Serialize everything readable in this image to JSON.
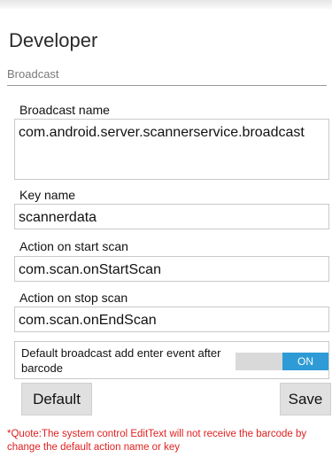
{
  "page": {
    "title": "Developer",
    "section": "Broadcast"
  },
  "broadcast_name": {
    "label": "Broadcast name",
    "value": "com.android.server.scannerservice.broadcast"
  },
  "key_name": {
    "label": "Key name",
    "value": "scannerdata"
  },
  "action_start": {
    "label": "Action on start scan",
    "value": "com.scan.onStartScan"
  },
  "action_stop": {
    "label": "Action on stop scan",
    "value": "com.scan.onEndScan"
  },
  "enter_toggle": {
    "label": "Default broadcast add enter event after barcode",
    "state": "ON"
  },
  "buttons": {
    "default_label": "Default",
    "save_label": "Save"
  },
  "note": "*Quote:The system control EditText will not receive the barcode by change the default action name or key",
  "colors": {
    "toggle_on": "#2e9bd6",
    "note_text": "#e02020"
  }
}
